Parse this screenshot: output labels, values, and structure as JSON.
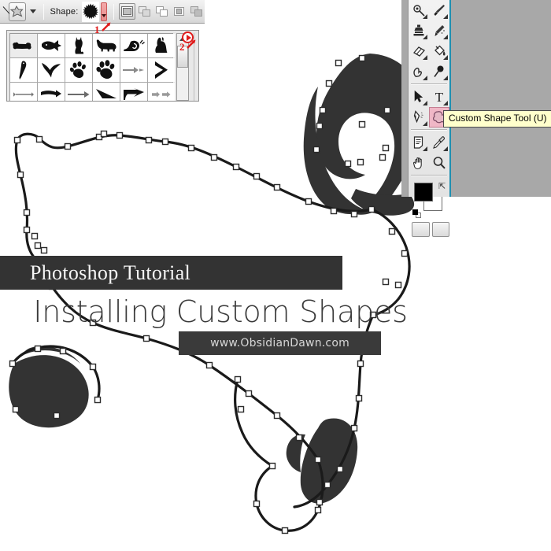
{
  "app": {
    "name": "Adobe Photoshop",
    "document_background": "#ffffff",
    "panel_background": "#a8a8a8",
    "accent_red": "#e01b1b",
    "highlight_pink": "#f0b7c6",
    "tooltip_background": "#ffffcc"
  },
  "options_bar": {
    "shape_label": "Shape:",
    "tool_preset_icon": "custom-shape-preset-icon",
    "preset_caret_icon": "chevron-down-icon",
    "shape_swatch_icon": "starburst-shape-icon",
    "shape_dropdown_caret_icon": "chevron-down-icon",
    "path_operations": [
      {
        "name": "create-new-shape-layer",
        "icon": "new-shape-layer-icon",
        "active": true
      },
      {
        "name": "add-to-shape-area",
        "icon": "add-shape-icon",
        "active": false
      },
      {
        "name": "subtract-from-shape-area",
        "icon": "subtract-shape-icon",
        "active": false
      },
      {
        "name": "intersect-shape-areas",
        "icon": "intersect-shape-icon",
        "active": false
      },
      {
        "name": "exclude-overlapping-shape-areas",
        "icon": "exclude-shape-icon",
        "active": false
      }
    ]
  },
  "shape_picker": {
    "visible": true,
    "scroll_up_icon": "scroll-up-arrow-icon",
    "rows": [
      [
        {
          "name": "bone-shape",
          "glyph": "bone"
        },
        {
          "name": "fish-shape",
          "glyph": "fish"
        },
        {
          "name": "cat-shape",
          "glyph": "cat"
        },
        {
          "name": "dog-shape",
          "glyph": "dog"
        },
        {
          "name": "snail-shape",
          "glyph": "snail"
        },
        {
          "name": "rabbit-shape",
          "glyph": "rabbit"
        }
      ],
      [
        {
          "name": "parrot-shape",
          "glyph": "parrot"
        },
        {
          "name": "bird-shape",
          "glyph": "bird"
        },
        {
          "name": "paw-print-small-shape",
          "glyph": "paw"
        },
        {
          "name": "paw-print-large-shape",
          "glyph": "paw2"
        },
        {
          "name": "thin-arrow-shape",
          "glyph": "thin-arrow"
        },
        {
          "name": "chevron-arrow-shape",
          "glyph": "chevron"
        }
      ],
      [
        {
          "name": "line-arrow-shape",
          "glyph": "line-arrow"
        },
        {
          "name": "block-arrow-shape",
          "glyph": "block-arrow"
        },
        {
          "name": "simple-arrow-shape",
          "glyph": "simple-arrow"
        },
        {
          "name": "wedge-arrow-shape",
          "glyph": "wedge"
        },
        {
          "name": "bent-arrow-shape",
          "glyph": "bent-arrow"
        },
        {
          "name": "double-thin-arrow-shape",
          "glyph": "double-thin"
        }
      ]
    ]
  },
  "annotations": [
    {
      "name": "annotation-step-1",
      "label": "1",
      "target": "shape-dropdown-button"
    },
    {
      "name": "annotation-step-2",
      "label": "2",
      "target": "shape-picker-flyout-button"
    }
  ],
  "toolbox": {
    "rows": [
      [
        {
          "name": "dodge-tool",
          "icon": "dodge-burn-icon",
          "has_flyout": true
        },
        {
          "name": "brush-tool",
          "icon": "paintbrush-icon",
          "has_flyout": true
        }
      ],
      [
        {
          "name": "clone-stamp-tool",
          "icon": "clone-stamp-icon",
          "has_flyout": true
        },
        {
          "name": "history-brush-tool",
          "icon": "history-brush-icon",
          "has_flyout": true
        }
      ],
      [
        {
          "name": "eraser-tool",
          "icon": "eraser-icon",
          "has_flyout": true
        },
        {
          "name": "paint-bucket-tool",
          "icon": "paint-bucket-icon",
          "has_flyout": true
        }
      ],
      [
        {
          "name": "smudge-tool",
          "icon": "smudge-finger-icon",
          "has_flyout": true
        },
        {
          "name": "blur-tool",
          "icon": "blur-droplet-icon",
          "has_flyout": true
        }
      ],
      [
        {
          "name": "path-selection-tool",
          "icon": "black-arrow-icon",
          "has_flyout": true
        },
        {
          "name": "type-tool",
          "icon": "text-t-icon",
          "has_flyout": true
        }
      ],
      [
        {
          "name": "pen-tool",
          "icon": "pen-nib-icon",
          "has_flyout": true
        },
        {
          "name": "custom-shape-tool",
          "icon": "custom-shape-blob-icon",
          "has_flyout": false,
          "active": true
        }
      ],
      [
        {
          "name": "notes-tool",
          "icon": "note-page-icon",
          "has_flyout": true
        },
        {
          "name": "eyedropper-tool",
          "icon": "eyedropper-icon",
          "has_flyout": true
        }
      ],
      [
        {
          "name": "hand-tool",
          "icon": "hand-icon",
          "has_flyout": false
        },
        {
          "name": "zoom-tool",
          "icon": "magnifier-icon",
          "has_flyout": false
        }
      ]
    ],
    "colors": {
      "foreground": "#000000",
      "background": "#ffffff",
      "swap_icon": "swap-colors-arrow-icon",
      "default_icon": "default-colors-icon"
    },
    "bottom_buttons": [
      {
        "name": "standard-mode-button",
        "icon": "standard-mask-mode-icon"
      },
      {
        "name": "quick-mask-mode-button",
        "icon": "quick-mask-mode-icon"
      }
    ]
  },
  "tooltip": {
    "name": "custom-shape-tool-tooltip",
    "text": "Custom Shape Tool (U)"
  },
  "banners": {
    "tutorial_label": "Photoshop Tutorial",
    "headline": "Installing Custom Shapes",
    "url": "www.ObsidianDawn.com"
  },
  "artwork": {
    "description": "Vector path with selected anchor points over a dark custom shape",
    "fill_color": "#333333",
    "path_stroke": "#1a1a1a",
    "anchor_fill": "#ffffff",
    "anchor_stroke": "#2b2b2b"
  }
}
